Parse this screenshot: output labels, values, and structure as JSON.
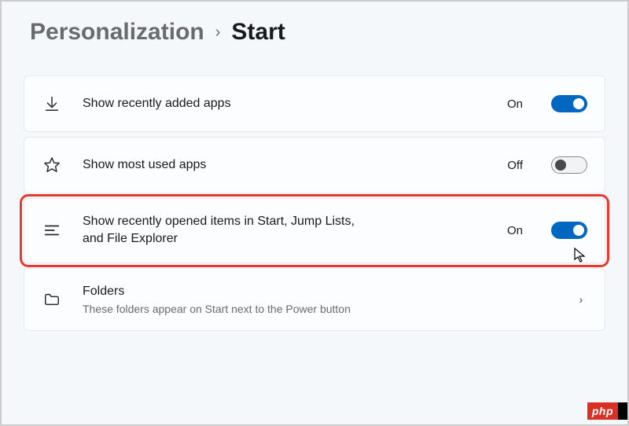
{
  "breadcrumb": {
    "parent": "Personalization",
    "current": "Start"
  },
  "items": [
    {
      "icon": "download",
      "title": "Show recently added apps",
      "subtitle": "",
      "state_label": "On",
      "toggle": "on",
      "highlighted": false,
      "has_chevron": false
    },
    {
      "icon": "star",
      "title": "Show most used apps",
      "subtitle": "",
      "state_label": "Off",
      "toggle": "off",
      "highlighted": false,
      "has_chevron": false
    },
    {
      "icon": "list",
      "title": "Show recently opened items in Start, Jump Lists, and File Explorer",
      "subtitle": "",
      "state_label": "On",
      "toggle": "on",
      "highlighted": true,
      "has_chevron": false
    },
    {
      "icon": "folder",
      "title": "Folders",
      "subtitle": "These folders appear on Start next to the Power button",
      "state_label": "",
      "toggle": "",
      "highlighted": false,
      "has_chevron": true
    }
  ],
  "watermark": "php"
}
